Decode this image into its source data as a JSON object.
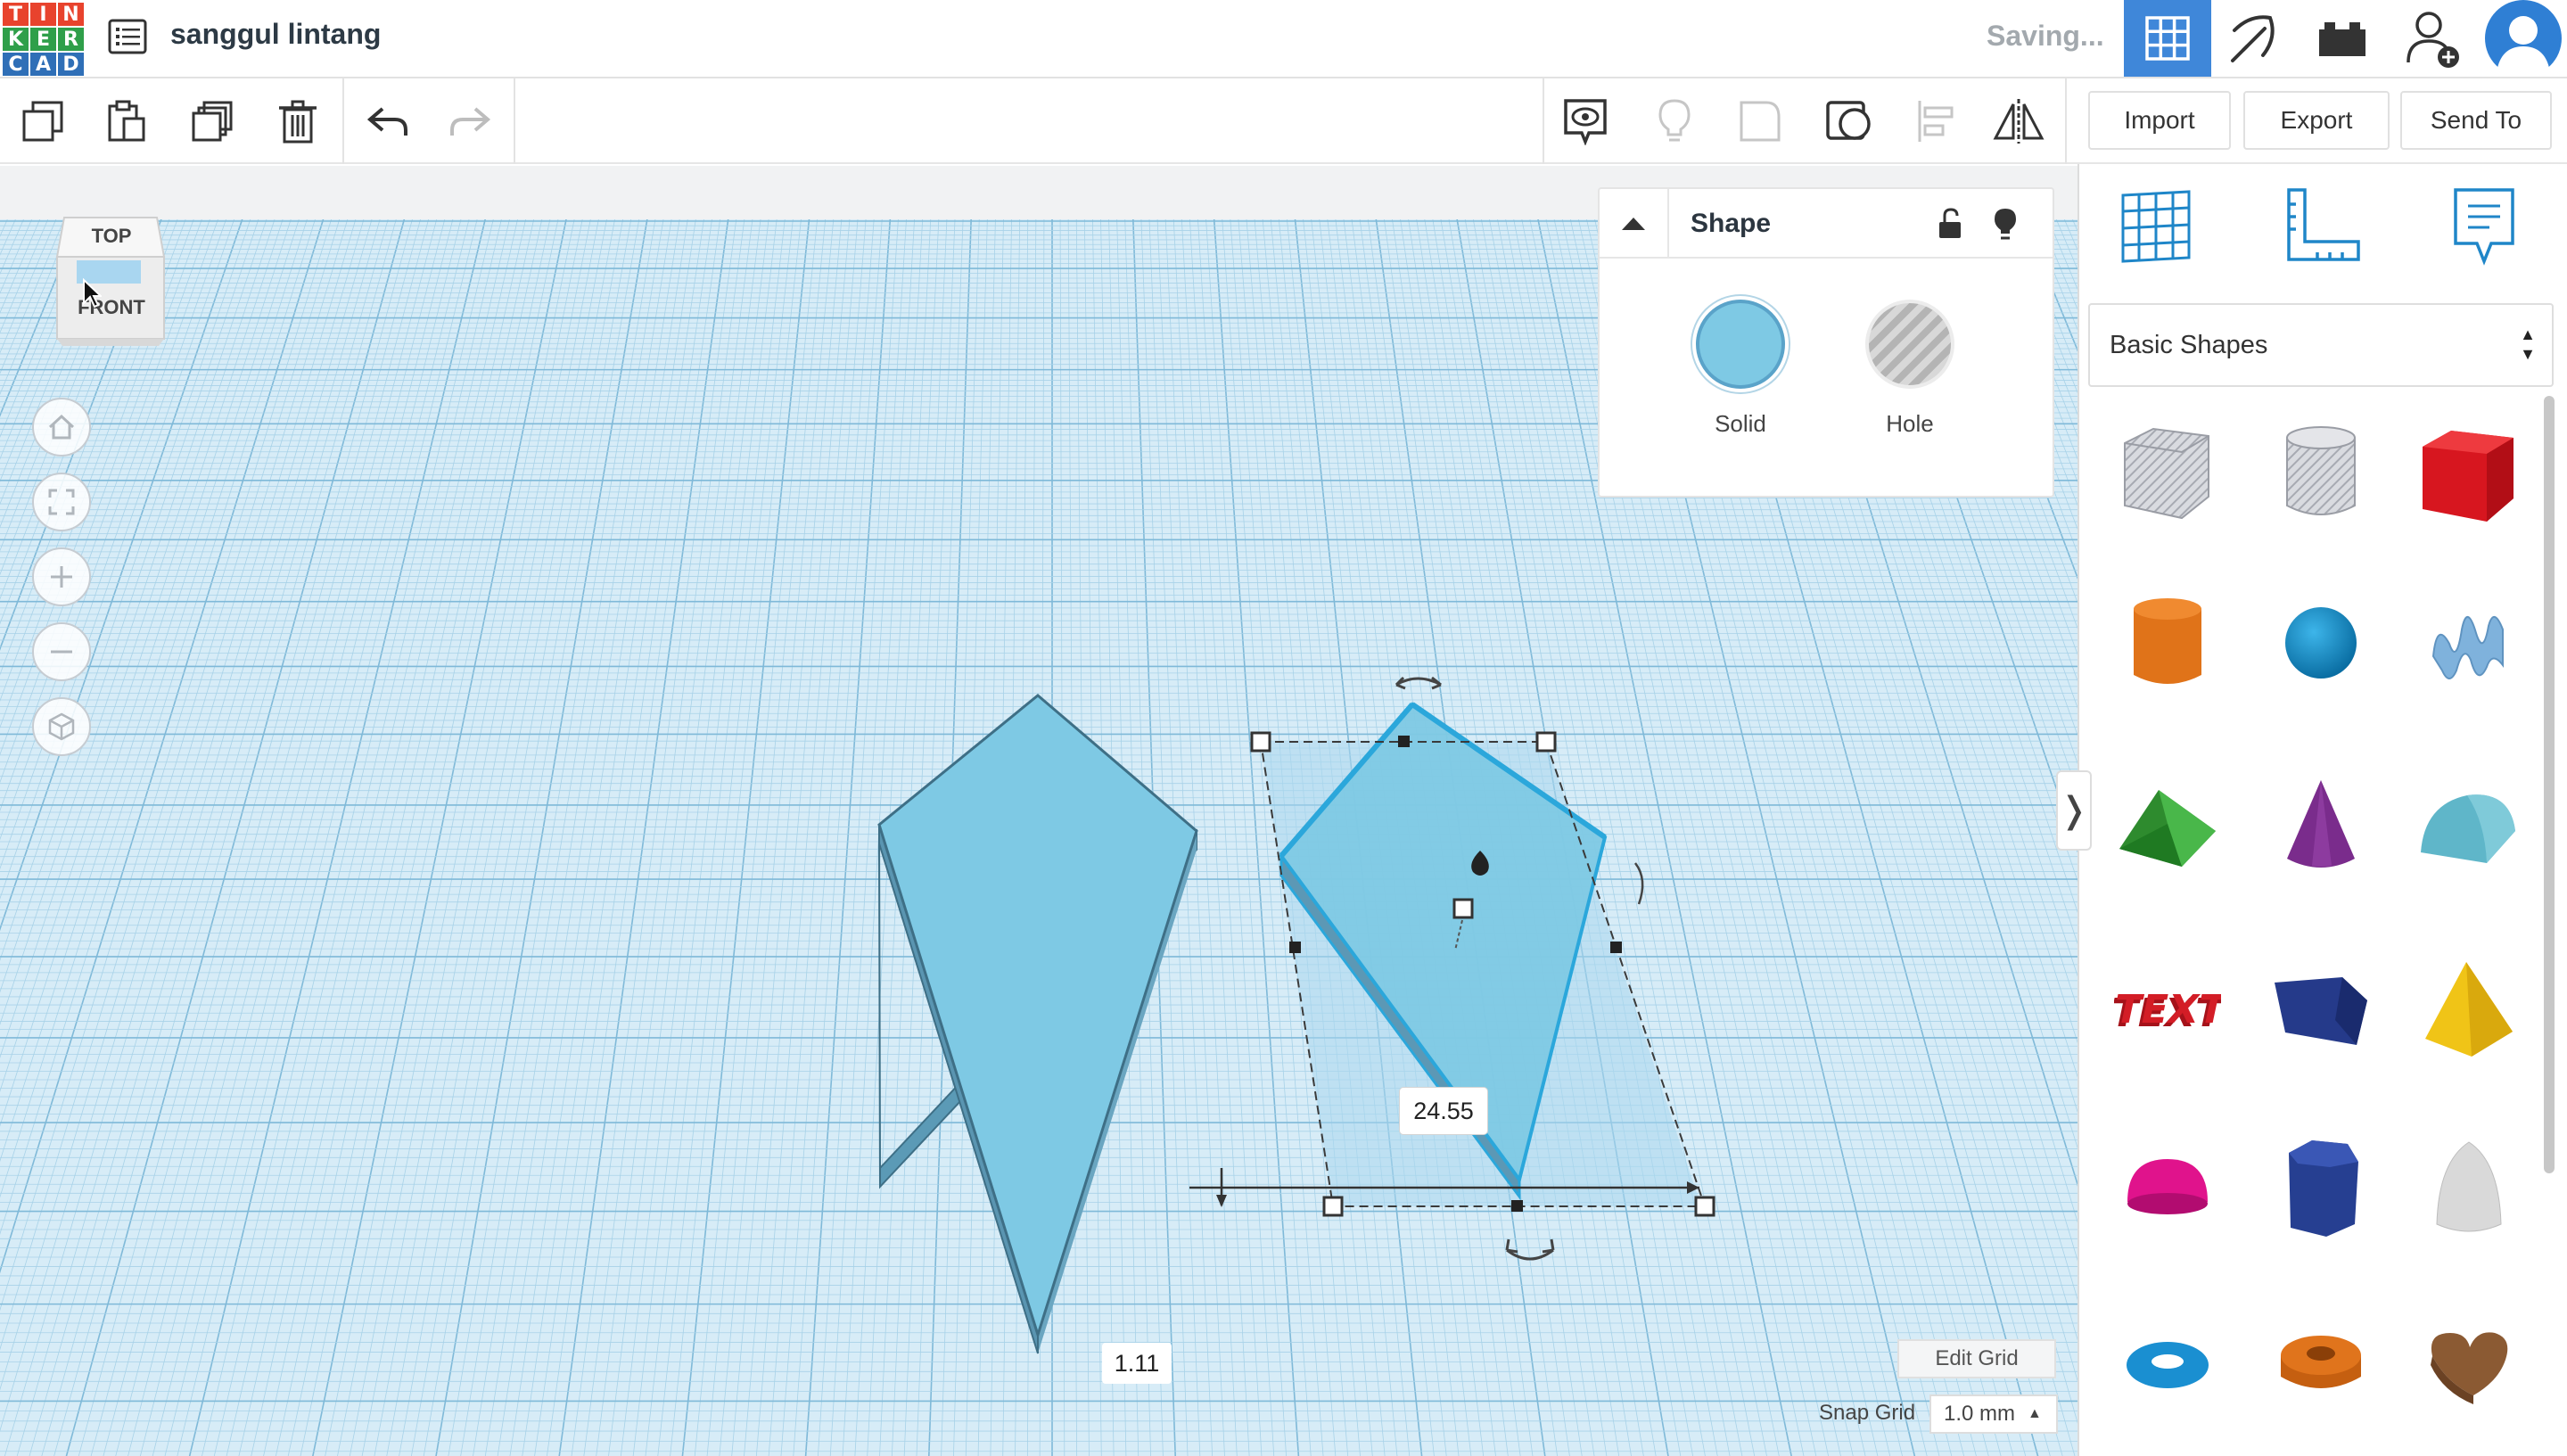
{
  "app": {
    "logo_letters": [
      "T",
      "I",
      "N",
      "K",
      "E",
      "R",
      "C",
      "A",
      "D"
    ],
    "logo_colors": [
      "#e8432d",
      "#e8432d",
      "#e8432d",
      "#2f9f4a",
      "#2f9f4a",
      "#2f9f4a",
      "#2f6fb7",
      "#2f6fb7",
      "#2f6fb7"
    ],
    "design_title": "sanggul lintang",
    "save_status": "Saving...",
    "accent_color": "#3f87d9"
  },
  "toolbar": {
    "import_label": "Import",
    "export_label": "Export",
    "send_to_label": "Send To"
  },
  "view_cube": {
    "top_label": "TOP",
    "front_label": "FRONT"
  },
  "inspector": {
    "title": "Shape",
    "solid_label": "Solid",
    "hole_label": "Hole",
    "solid_color": "#7ec9e4"
  },
  "workplane": {
    "width_dimension": "24.55",
    "offset_dimension": "1.11",
    "edit_grid_label": "Edit Grid",
    "snap_grid_label": "Snap Grid",
    "snap_grid_value": "1.0 mm"
  },
  "shapes_panel": {
    "category": "Basic Shapes",
    "items": [
      {
        "name": "box-hole",
        "color": "#c9cbd0"
      },
      {
        "name": "cylinder-hole",
        "color": "#c9cbd0"
      },
      {
        "name": "box",
        "color": "#d7161f"
      },
      {
        "name": "cylinder",
        "color": "#e07319"
      },
      {
        "name": "sphere",
        "color": "#1b97d4"
      },
      {
        "name": "scribble",
        "color": "#7fb2dc"
      },
      {
        "name": "roof",
        "color": "#3aa33d"
      },
      {
        "name": "cone",
        "color": "#7a2c8c"
      },
      {
        "name": "round-roof",
        "color": "#5fb6c9"
      },
      {
        "name": "text",
        "color": "#d31d26"
      },
      {
        "name": "wedge",
        "color": "#253a8a"
      },
      {
        "name": "pyramid",
        "color": "#f0c417"
      },
      {
        "name": "half-sphere",
        "color": "#e0138c"
      },
      {
        "name": "polygon",
        "color": "#263f91"
      },
      {
        "name": "paraboloid",
        "color": "#d9d9d9"
      },
      {
        "name": "torus",
        "color": "#1a8fd1"
      },
      {
        "name": "tube",
        "color": "#e0741c"
      },
      {
        "name": "heart",
        "color": "#8b5a33"
      }
    ]
  }
}
